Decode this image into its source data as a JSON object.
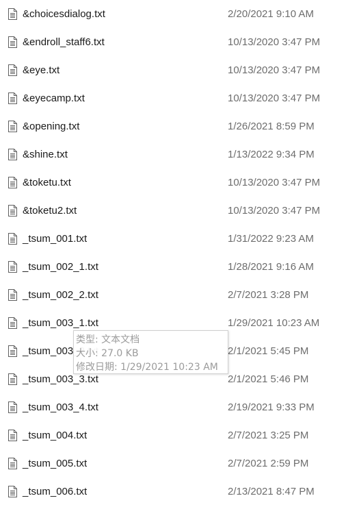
{
  "files": [
    {
      "name": "&choicesdialog.txt",
      "date": "2/20/2021 9:10 AM"
    },
    {
      "name": "&endroll_staff6.txt",
      "date": "10/13/2020 3:47 PM"
    },
    {
      "name": "&eye.txt",
      "date": "10/13/2020 3:47 PM"
    },
    {
      "name": "&eyecamp.txt",
      "date": "10/13/2020 3:47 PM"
    },
    {
      "name": "&opening.txt",
      "date": "1/26/2021 8:59 PM"
    },
    {
      "name": "&shine.txt",
      "date": "1/13/2022 9:34 PM"
    },
    {
      "name": "&toketu.txt",
      "date": "10/13/2020 3:47 PM"
    },
    {
      "name": "&toketu2.txt",
      "date": "10/13/2020 3:47 PM"
    },
    {
      "name": "_tsum_001.txt",
      "date": "1/31/2022 9:23 AM"
    },
    {
      "name": "_tsum_002_1.txt",
      "date": "1/28/2021 9:16 AM"
    },
    {
      "name": "_tsum_002_2.txt",
      "date": "2/7/2021 3:28 PM"
    },
    {
      "name": "_tsum_003_1.txt",
      "date": "1/29/2021 10:23 AM"
    },
    {
      "name": "_tsum_003_2.txt",
      "date": "2/1/2021 5:45 PM"
    },
    {
      "name": "_tsum_003_3.txt",
      "date": "2/1/2021 5:46 PM"
    },
    {
      "name": "_tsum_003_4.txt",
      "date": "2/19/2021 9:33 PM"
    },
    {
      "name": "_tsum_004.txt",
      "date": "2/7/2021 3:25 PM"
    },
    {
      "name": "_tsum_005.txt",
      "date": "2/7/2021 2:59 PM"
    },
    {
      "name": "_tsum_006.txt",
      "date": "2/13/2021 8:47 PM"
    }
  ],
  "tooltip": {
    "type_line": "类型: 文本文档",
    "size_line": "大小: 27.0 KB",
    "modified_line": "修改日期: 1/29/2021 10:23 AM"
  },
  "colors": {
    "name_text": "#1a1a1a",
    "date_text": "#6d6d6d",
    "icon_stroke": "#5f5f5f",
    "tooltip_text": "#9b9b9b"
  }
}
